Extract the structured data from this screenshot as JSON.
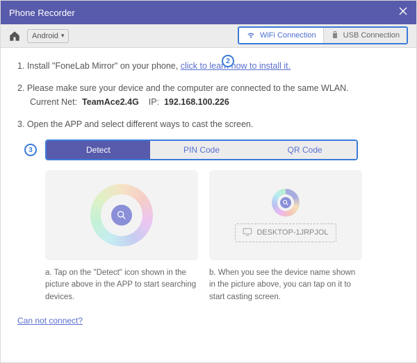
{
  "window": {
    "title": "Phone Recorder"
  },
  "toolbar": {
    "os_label": "Android",
    "wifi_label": "WiFi Connection",
    "usb_label": "USB Connection"
  },
  "markers": {
    "m2": "2",
    "m3": "3"
  },
  "steps": {
    "s1_prefix": "1. Install \"FoneLab Mirror\" on your phone, ",
    "s1_link": "click to learn how to install it.",
    "s2": "2. Please make sure your device and the computer are connected to the same WLAN.",
    "net_label": "Current Net:",
    "net_value": "TeamAce2.4G",
    "ip_label": "IP:",
    "ip_value": "192.168.100.226",
    "s3": "3. Open the APP and select different ways to cast the screen."
  },
  "tabs": {
    "detect": "Detect",
    "pin": "PIN Code",
    "qr": "QR Code"
  },
  "device_name": "DESKTOP-1JRPJOL",
  "captions": {
    "a": "a. Tap on the \"Detect\" icon shown in the picture above in the APP to start searching devices.",
    "b": "b. When you see the device name shown in the picture above, you can tap on it to start casting screen."
  },
  "footer": {
    "cannot_connect": "Can not connect?"
  }
}
